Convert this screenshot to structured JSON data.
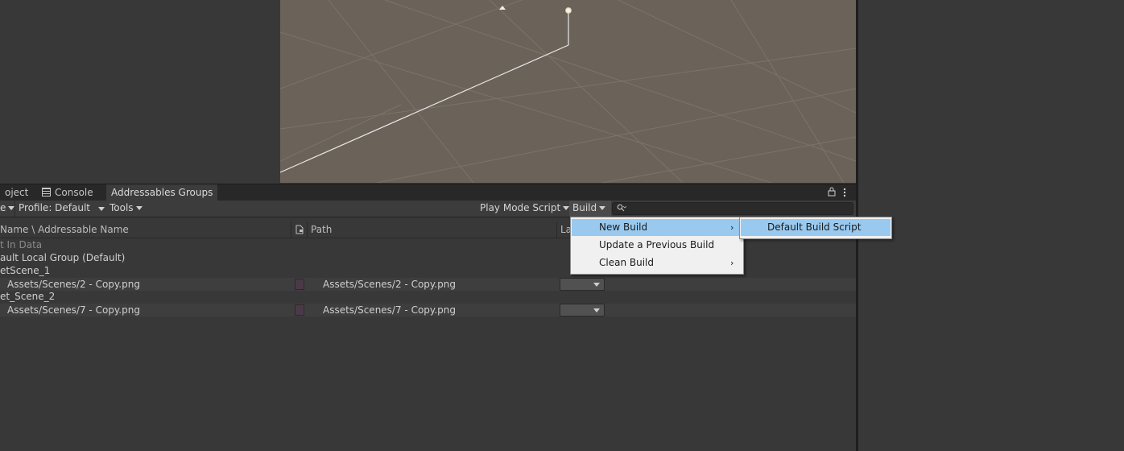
{
  "tabs": [
    {
      "label": "oject"
    },
    {
      "label": "Console"
    },
    {
      "label": "Addressables Groups"
    }
  ],
  "toolbar": {
    "left_cut": "e",
    "profile": "Profile: Default",
    "tools": "Tools",
    "play_mode": "Play Mode Script",
    "build": "Build",
    "search_placeholder": ""
  },
  "columns": {
    "name": "Name \\ Addressable Name",
    "path": "Path",
    "labels": "La"
  },
  "rows": [
    {
      "name": "t In Data"
    },
    {
      "name": "ault Local Group (Default)"
    },
    {
      "name": "etScene_1"
    },
    {
      "name": "Assets/Scenes/2 - Copy.png",
      "path": "Assets/Scenes/2 - Copy.png"
    },
    {
      "name": "et_Scene_2"
    },
    {
      "name": "Assets/Scenes/7 - Copy.png",
      "path": "Assets/Scenes/7 - Copy.png"
    }
  ],
  "build_menu": {
    "items": [
      {
        "label": "New Build",
        "has_submenu": true
      },
      {
        "label": "Update a Previous Build",
        "has_submenu": false
      },
      {
        "label": "Clean Build",
        "has_submenu": true
      }
    ],
    "submenu": [
      {
        "label": "Default Build Script"
      }
    ]
  },
  "colors": {
    "highlight": "#99c9ef",
    "scene_bg": "#6b625a"
  }
}
